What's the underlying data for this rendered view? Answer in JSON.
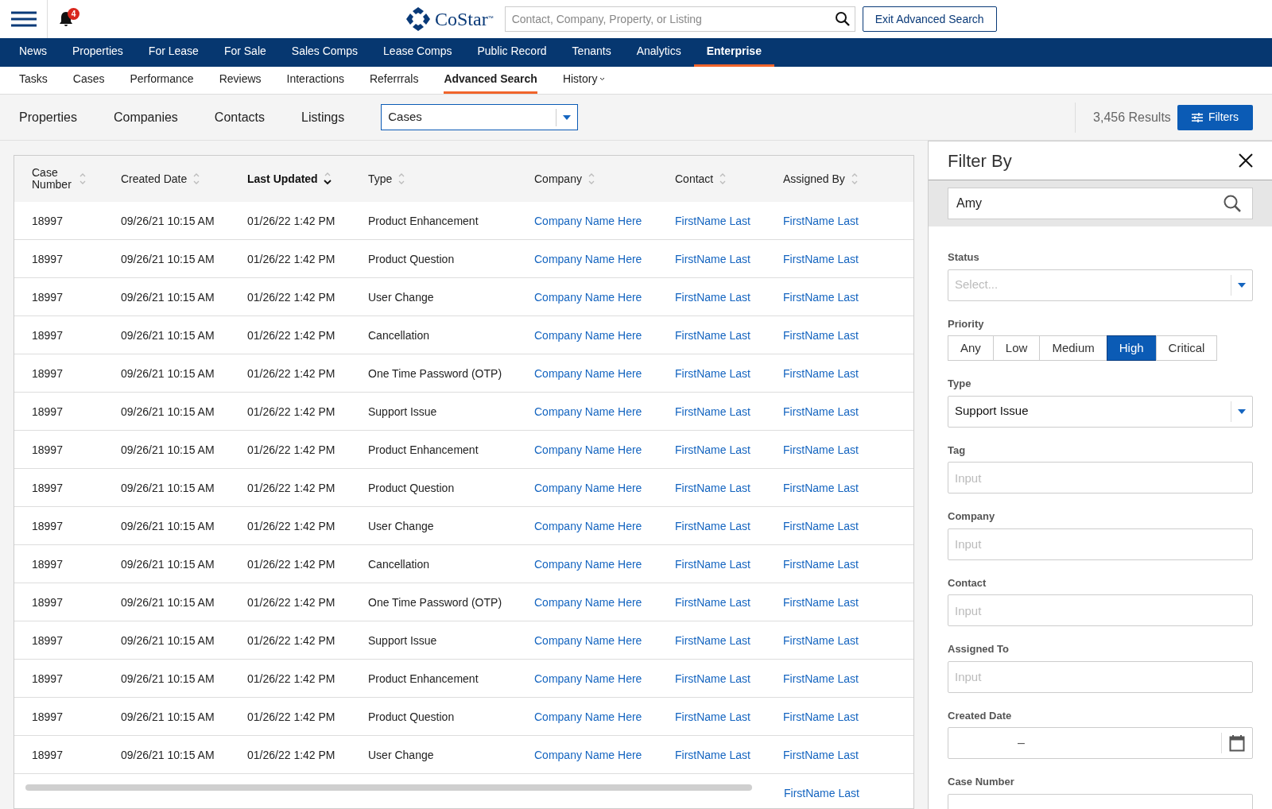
{
  "header": {
    "notification_count": "4",
    "brand": "CoStar",
    "brand_mark": "™",
    "search": {
      "placeholder": "Contact, Company, Property, or Listing"
    },
    "exit_button": "Exit Advanced Search"
  },
  "main_nav": [
    {
      "label": "News",
      "selected": false
    },
    {
      "label": "Properties",
      "selected": false
    },
    {
      "label": "For Lease",
      "selected": false
    },
    {
      "label": "For Sale",
      "selected": false
    },
    {
      "label": "Sales Comps",
      "selected": false
    },
    {
      "label": "Lease Comps",
      "selected": false
    },
    {
      "label": "Public Record",
      "selected": false
    },
    {
      "label": "Tenants",
      "selected": false
    },
    {
      "label": "Analytics",
      "selected": false
    },
    {
      "label": "Enterprise",
      "selected": true
    }
  ],
  "sub_nav": [
    {
      "label": "Tasks",
      "selected": false,
      "dropdown": false
    },
    {
      "label": "Cases",
      "selected": false,
      "dropdown": false
    },
    {
      "label": "Performance",
      "selected": false,
      "dropdown": false
    },
    {
      "label": "Reviews",
      "selected": false,
      "dropdown": false
    },
    {
      "label": "Interactions",
      "selected": false,
      "dropdown": false
    },
    {
      "label": "Referrrals",
      "selected": false,
      "dropdown": false
    },
    {
      "label": "Advanced Search",
      "selected": true,
      "dropdown": false
    },
    {
      "label": "History",
      "selected": false,
      "dropdown": true
    }
  ],
  "search_tabs": [
    "Properties",
    "Companies",
    "Contacts",
    "Listings"
  ],
  "entity_select": {
    "value": "Cases"
  },
  "results": "3,456 Results",
  "filters_button": "Filters",
  "table": {
    "columns": [
      {
        "label": "Case Number",
        "sorted": false
      },
      {
        "label": "Created Date",
        "sorted": false
      },
      {
        "label": "Last Updated",
        "sorted": true
      },
      {
        "label": "Type",
        "sorted": false
      },
      {
        "label": "Company",
        "sorted": false
      },
      {
        "label": "Contact",
        "sorted": false
      },
      {
        "label": "Assigned By",
        "sorted": false
      }
    ],
    "rows": [
      [
        "18997",
        "09/26/21 10:15 AM",
        "01/26/22 1:42 PM",
        "Product Enhancement",
        "Company Name Here",
        "FirstName Last",
        "FirstName Last"
      ],
      [
        "18997",
        "09/26/21 10:15 AM",
        "01/26/22 1:42 PM",
        "Product Question",
        "Company Name Here",
        "FirstName Last",
        "FirstName Last"
      ],
      [
        "18997",
        "09/26/21 10:15 AM",
        "01/26/22 1:42 PM",
        "User Change",
        "Company Name Here",
        "FirstName Last",
        "FirstName Last"
      ],
      [
        "18997",
        "09/26/21 10:15 AM",
        "01/26/22 1:42 PM",
        "Cancellation",
        "Company Name Here",
        "FirstName Last",
        "FirstName Last"
      ],
      [
        "18997",
        "09/26/21 10:15 AM",
        "01/26/22 1:42 PM",
        "One Time Password (OTP)",
        "Company Name Here",
        "FirstName Last",
        "FirstName Last"
      ],
      [
        "18997",
        "09/26/21 10:15 AM",
        "01/26/22 1:42 PM",
        "Support Issue",
        "Company Name Here",
        "FirstName Last",
        "FirstName Last"
      ],
      [
        "18997",
        "09/26/21 10:15 AM",
        "01/26/22 1:42 PM",
        "Product Enhancement",
        "Company Name Here",
        "FirstName Last",
        "FirstName Last"
      ],
      [
        "18997",
        "09/26/21 10:15 AM",
        "01/26/22 1:42 PM",
        "Product Question",
        "Company Name Here",
        "FirstName Last",
        "FirstName Last"
      ],
      [
        "18997",
        "09/26/21 10:15 AM",
        "01/26/22 1:42 PM",
        "User Change",
        "Company Name Here",
        "FirstName Last",
        "FirstName Last"
      ],
      [
        "18997",
        "09/26/21 10:15 AM",
        "01/26/22 1:42 PM",
        "Cancellation",
        "Company Name Here",
        "FirstName Last",
        "FirstName Last"
      ],
      [
        "18997",
        "09/26/21 10:15 AM",
        "01/26/22 1:42 PM",
        "One Time Password (OTP)",
        "Company Name Here",
        "FirstName Last",
        "FirstName Last"
      ],
      [
        "18997",
        "09/26/21 10:15 AM",
        "01/26/22 1:42 PM",
        "Support Issue",
        "Company Name Here",
        "FirstName Last",
        "FirstName Last"
      ],
      [
        "18997",
        "09/26/21 10:15 AM",
        "01/26/22 1:42 PM",
        "Product Enhancement",
        "Company Name Here",
        "FirstName Last",
        "FirstName Last"
      ],
      [
        "18997",
        "09/26/21 10:15 AM",
        "01/26/22 1:42 PM",
        "Product Question",
        "Company Name Here",
        "FirstName Last",
        "FirstName Last"
      ],
      [
        "18997",
        "09/26/21 10:15 AM",
        "01/26/22 1:42 PM",
        "User Change",
        "Company Name Here",
        "FirstName Last",
        "FirstName Last"
      ]
    ],
    "partial_row": {
      "assigned_by": "FirstName Last"
    }
  },
  "filter_panel": {
    "title": "Filter By",
    "search": {
      "value": "Amy"
    },
    "fields": [
      {
        "kind": "select",
        "label": "Status",
        "placeholder": "Select..."
      },
      {
        "kind": "segmented",
        "label": "Priority",
        "options": [
          {
            "label": "Any",
            "selected": false
          },
          {
            "label": "Low",
            "selected": false
          },
          {
            "label": "Medium",
            "selected": false
          },
          {
            "label": "High",
            "selected": true
          },
          {
            "label": "Critical",
            "selected": false
          }
        ]
      },
      {
        "kind": "select",
        "label": "Type",
        "value": "Support Issue"
      },
      {
        "kind": "input",
        "label": "Tag",
        "placeholder": "Input"
      },
      {
        "kind": "input",
        "label": "Company",
        "placeholder": "Input"
      },
      {
        "kind": "input",
        "label": "Contact",
        "placeholder": "Input"
      },
      {
        "kind": "input",
        "label": "Assigned To",
        "placeholder": "Input"
      },
      {
        "kind": "daterange",
        "label": "Created Date",
        "separator": "–"
      },
      {
        "kind": "input",
        "label": "Case Number"
      }
    ]
  }
}
